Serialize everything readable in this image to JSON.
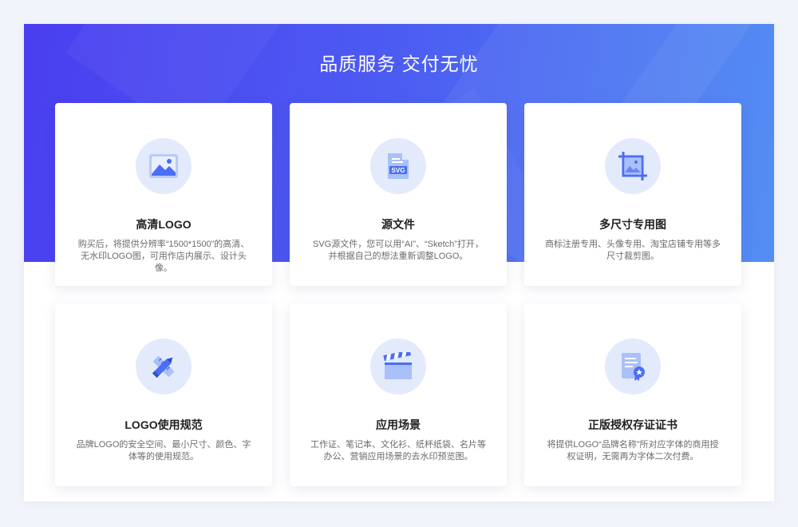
{
  "headline": "品质服务 交付无忧",
  "cards": [
    {
      "icon": "image-icon",
      "title": "高清LOGO",
      "desc": "购买后，将提供分辨率“1500*1500”的高清、无水印LOGO图，可用作店内展示、设计头像。"
    },
    {
      "icon": "svg-file-icon",
      "title": "源文件",
      "desc": "SVG源文件，您可以用“AI”、“Sketch”打开，并根据自己的想法重新调整LOGO。",
      "badge": "SVG"
    },
    {
      "icon": "crop-image-icon",
      "title": "多尺寸专用图",
      "desc": "商标注册专用、头像专用、淘宝店铺专用等多尺寸裁剪图。"
    },
    {
      "icon": "ruler-pencil-icon",
      "title": "LOGO使用规范",
      "desc": "品牌LOGO的安全空间、最小尺寸、颜色、字体等的使用规范。"
    },
    {
      "icon": "clapperboard-icon",
      "title": "应用场景",
      "desc": "工作证、笔记本、文化衫、纸杯纸袋、名片等办公、营销应用场景的去水印预览图。"
    },
    {
      "icon": "certificate-icon",
      "title": "正版授权存证证书",
      "desc": "将提供LOGO“品牌名称”所对应字体的商用授权证明，无需再为字体二次付费。"
    }
  ],
  "colors": {
    "accent": "#4a6ef5",
    "icon_light": "#a9c0f8",
    "icon_bg": "#e3eafc"
  }
}
